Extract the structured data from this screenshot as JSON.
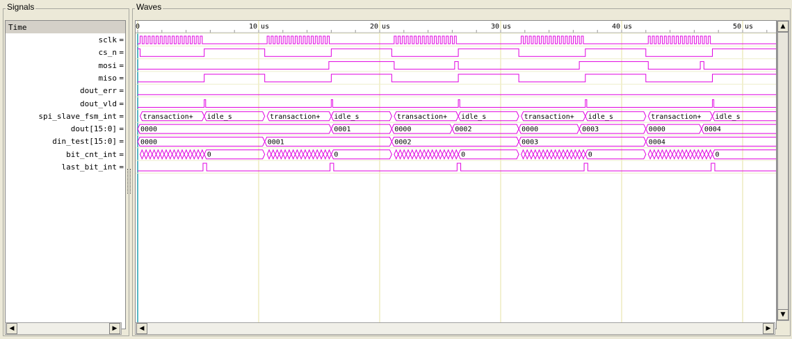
{
  "panels": {
    "signals_title": "Signals",
    "waves_title": "Waves"
  },
  "time_header": "Time",
  "time_axis": {
    "ticks": [
      {
        "value": 0,
        "label": "0"
      },
      {
        "value": 10,
        "label": "10 us"
      },
      {
        "value": 20,
        "label": "20 us"
      },
      {
        "value": 30,
        "label": "30 us"
      },
      {
        "value": 40,
        "label": "40 us"
      },
      {
        "value": 50,
        "label": "50 us"
      }
    ],
    "unit": "us"
  },
  "signals": [
    {
      "name": "sclk",
      "eq": "="
    },
    {
      "name": "cs_n",
      "eq": "="
    },
    {
      "name": "mosi",
      "eq": "="
    },
    {
      "name": "miso",
      "eq": "="
    },
    {
      "name": "dout_err",
      "eq": "="
    },
    {
      "name": "dout_vld",
      "eq": "="
    },
    {
      "name": "spi_slave_fsm_int",
      "eq": "="
    },
    {
      "name": "dout[15:0]",
      "eq": "="
    },
    {
      "name": "din_test[15:0]",
      "eq": "="
    },
    {
      "name": "bit_cnt_int",
      "eq": "="
    },
    {
      "name": "last_bit_int",
      "eq": "="
    }
  ],
  "bus_labels": {
    "fsm": [
      "transaction+",
      "idle_s",
      "transaction+",
      "idle_s",
      "transaction+",
      "idle_s",
      "transaction+",
      "idle_s",
      "transaction+",
      "idle_s"
    ],
    "dout": [
      "0000",
      "0001",
      "0000",
      "0002",
      "0000",
      "0003",
      "0000",
      "0004"
    ],
    "din_test": [
      "0000",
      "0001",
      "0002",
      "0003",
      "0004"
    ],
    "bit_cnt": [
      "0",
      "0",
      "0",
      "0",
      "0"
    ]
  },
  "colors": {
    "wave": "#e000e0",
    "grid": "#e6e0a0",
    "cursor": "#20a0b0"
  },
  "icons": {
    "left": "arrow-left-icon",
    "right": "arrow-right-icon",
    "up": "arrow-up-icon",
    "down": "arrow-down-icon"
  },
  "glyphs": {
    "left": "◀",
    "right": "▶",
    "up": "▲",
    "down": "▼"
  }
}
